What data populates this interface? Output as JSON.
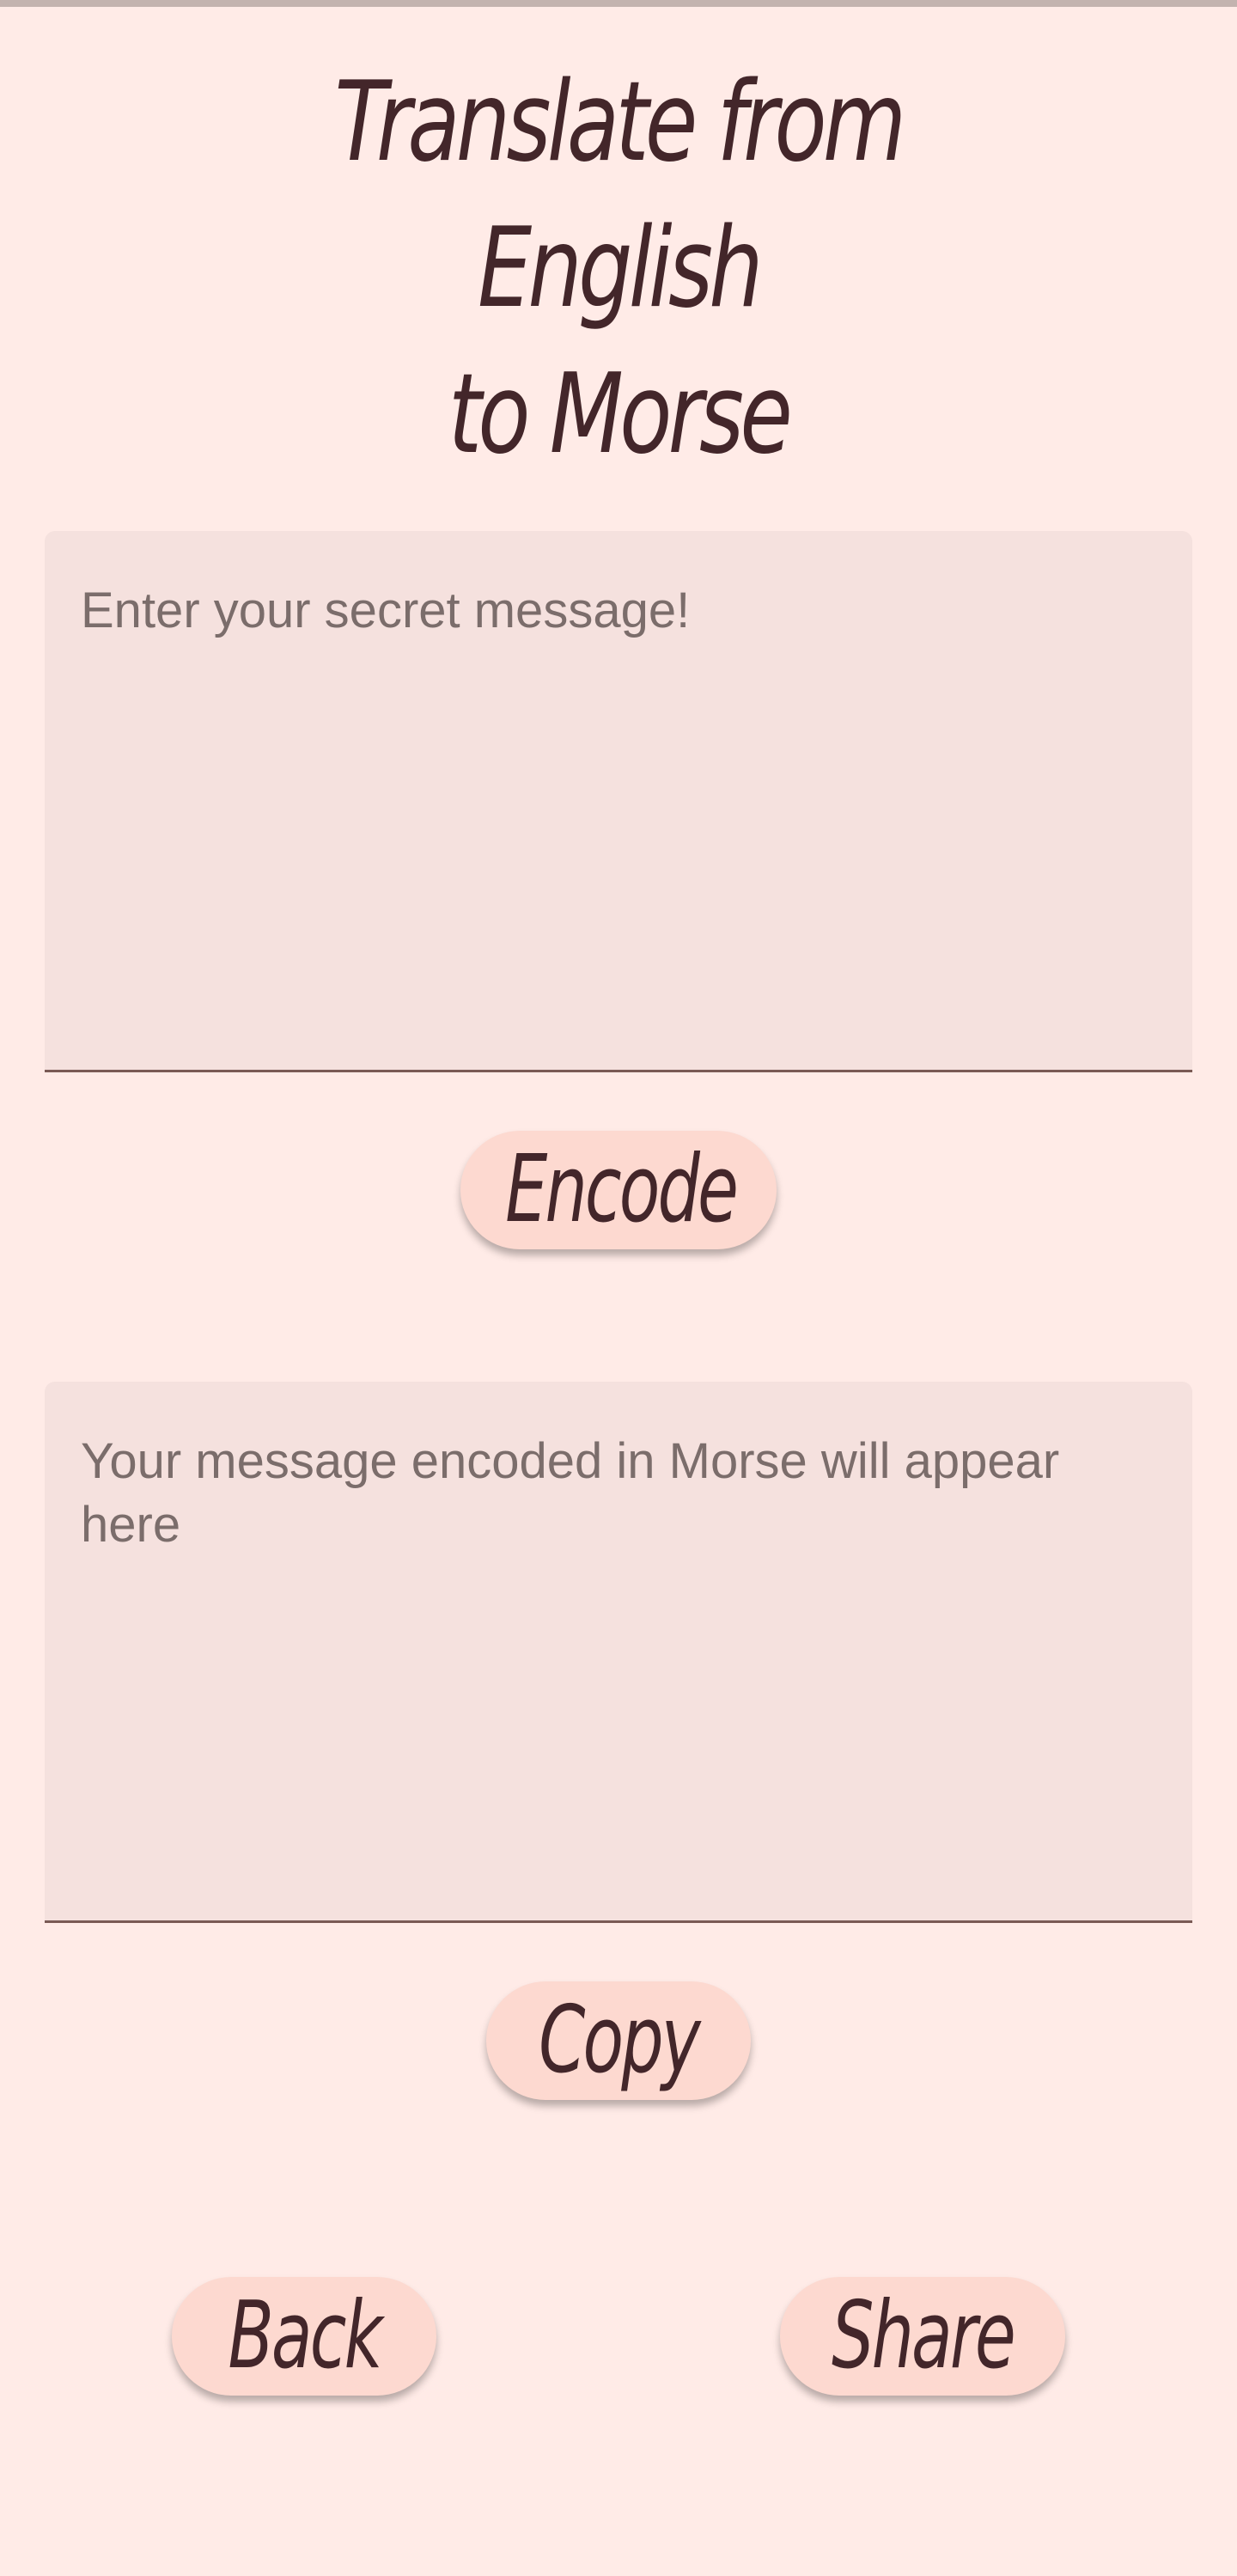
{
  "header": {
    "title_line1": "Translate from English",
    "title_line2": "to Morse"
  },
  "input": {
    "placeholder": "Enter your secret message!",
    "value": ""
  },
  "buttons": {
    "encode_label": "Encode",
    "copy_label": "Copy",
    "back_label": "Back",
    "share_label": "Share"
  },
  "output": {
    "placeholder": "Your message encoded in Morse will appear here",
    "value": ""
  },
  "colors": {
    "background": "#ffebe7",
    "field_background": "#f5e1de",
    "button_background": "#fdd9d0",
    "text_dark": "#43262a",
    "placeholder_text": "#7b6d6b",
    "underline": "#7a5a55"
  }
}
